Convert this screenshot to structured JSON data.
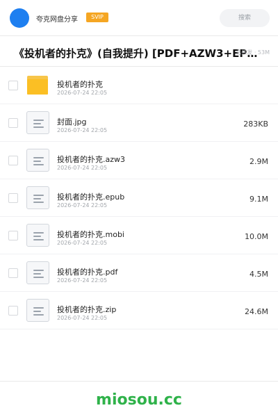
{
  "header": {
    "brand": "夸克网盘分享",
    "badge": "SVIP",
    "search_placeholder": "搜索"
  },
  "title": {
    "text": "《投机者的扑克》(自我提升) [PDF+AZW3+EPUB+M…",
    "overlay": "总共发 · 53M"
  },
  "files": [
    {
      "type": "folder",
      "name": "投机者的扑克",
      "date": "2026-07-24 22:05",
      "size": ""
    },
    {
      "type": "file",
      "name": "封面.jpg",
      "date": "2026-07-24 22:05",
      "size": "283KB"
    },
    {
      "type": "file",
      "name": "投机者的扑克.azw3",
      "date": "2026-07-24 22:05",
      "size": "2.9M"
    },
    {
      "type": "file",
      "name": "投机者的扑克.epub",
      "date": "2026-07-24 22:05",
      "size": "9.1M"
    },
    {
      "type": "file",
      "name": "投机者的扑克.mobi",
      "date": "2026-07-24 22:05",
      "size": "10.0M"
    },
    {
      "type": "file",
      "name": "投机者的扑克.pdf",
      "date": "2026-07-24 22:05",
      "size": "4.5M"
    },
    {
      "type": "file",
      "name": "投机者的扑克.zip",
      "date": "2026-07-24 22:05",
      "size": "24.6M"
    }
  ],
  "footer": {
    "brand": "miosou.cc"
  },
  "colors": {
    "avatar": "#1e7ff0",
    "svip_badge": "#f5a623",
    "folder": "#fbbf24",
    "footer_brand": "#2fb24a"
  },
  "icons": {
    "folder": "folder-icon",
    "file": "document-icon"
  }
}
